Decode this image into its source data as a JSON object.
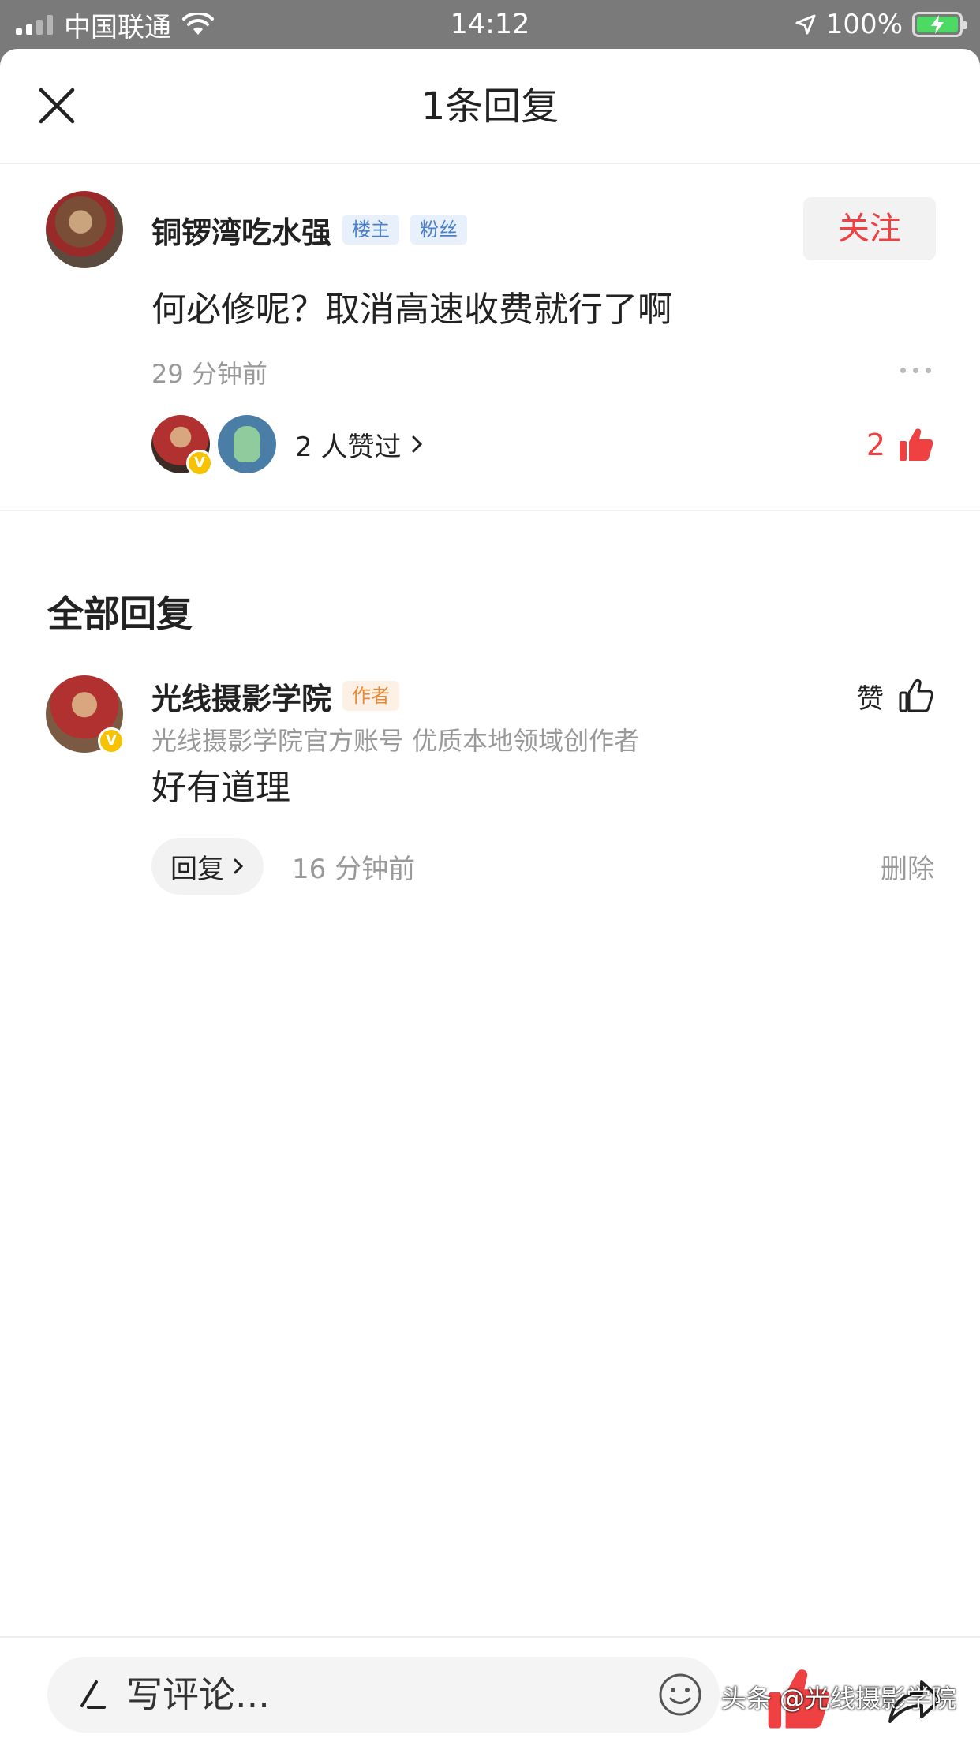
{
  "status_bar": {
    "carrier": "中国联通",
    "time": "14:12",
    "battery": "100%"
  },
  "header": {
    "title": "1条回复"
  },
  "main_comment": {
    "username": "铜锣湾吃水强",
    "tags": [
      "楼主",
      "粉丝"
    ],
    "follow_label": "关注",
    "text": "何必修呢？取消高速收费就行了啊",
    "time": "29 分钟前",
    "likers_text": "2 人赞过",
    "like_count": "2"
  },
  "replies_section": {
    "title": "全部回复"
  },
  "reply": {
    "username": "光线摄影学院",
    "tag": "作者",
    "subtitle": "光线摄影学院官方账号 优质本地领域创作者",
    "text": "好有道理",
    "like_label": "赞",
    "reply_label": "回复",
    "time": "16 分钟前",
    "delete_label": "删除"
  },
  "bottom_bar": {
    "placeholder": "写评论...",
    "watermark": "头条 @光线摄影学院"
  },
  "colors": {
    "accent_red": "#f04142",
    "tag_blue": "#4a7fc9",
    "tag_orange": "#e58a3a",
    "verified_yellow": "#f7c300"
  }
}
